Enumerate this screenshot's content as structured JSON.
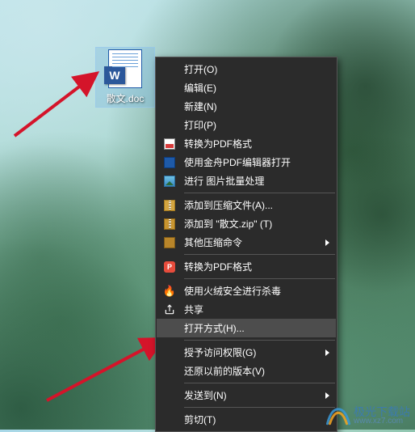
{
  "desktop": {
    "file_label": "散文.doc"
  },
  "context_menu": {
    "open": "打开(O)",
    "edit": "编辑(E)",
    "new": "新建(N)",
    "print": "打印(P)",
    "to_pdf": "转换为PDF格式",
    "jinzhou_pdf": "使用金舟PDF编辑器打开",
    "batch_img": "进行 图片批量处理",
    "add_archive": "添加到压缩文件(A)...",
    "add_zip": "添加到 \"散文.zip\" (T)",
    "other_zip": "其他压缩命令",
    "to_pdf2": "转换为PDF格式",
    "huorong": "使用火绒安全进行杀毒",
    "share": "共享",
    "open_with": "打开方式(H)...",
    "grant_access": "授予访问权限(G)",
    "restore_prev": "还原以前的版本(V)",
    "send_to": "发送到(N)",
    "cut": "剪切(T)"
  },
  "watermark": {
    "site_name": "极光下载站",
    "site_url": "www.xz7.com"
  }
}
